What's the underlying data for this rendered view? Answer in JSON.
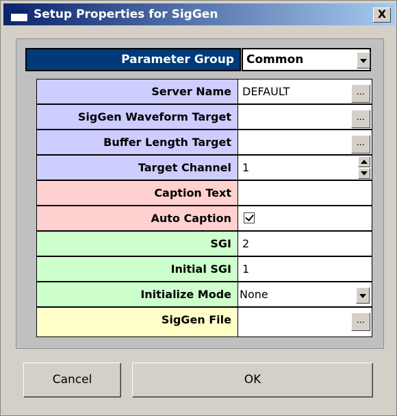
{
  "window": {
    "title": "Setup Properties for SigGen",
    "close_glyph": "X"
  },
  "parameter_group": {
    "label": "Parameter Group",
    "value": "Common"
  },
  "rows": [
    {
      "label": "Server Name",
      "value": "DEFAULT",
      "control": "ellipsis",
      "color": "#cdcdff"
    },
    {
      "label": "SigGen Waveform Target",
      "value": "",
      "control": "ellipsis",
      "color": "#cdcdff"
    },
    {
      "label": "Buffer Length Target",
      "value": "",
      "control": "ellipsis",
      "color": "#cdcdff"
    },
    {
      "label": "Target Channel",
      "value": "1",
      "control": "spinner",
      "color": "#cdcdff"
    },
    {
      "label": "Caption Text",
      "value": "",
      "control": "text",
      "color": "#ffd0d0"
    },
    {
      "label": "Auto Caption",
      "value": "",
      "checked": true,
      "control": "checkbox",
      "color": "#ffd0d0"
    },
    {
      "label": "SGI",
      "value": "2",
      "control": "text",
      "color": "#cdffcd"
    },
    {
      "label": "Initial SGI",
      "value": "1",
      "control": "text",
      "color": "#cdffcd"
    },
    {
      "label": "Initialize Mode",
      "value": "None",
      "control": "dropdown",
      "color": "#cdffcd"
    },
    {
      "label": "SigGen File",
      "value": "",
      "control": "ellipsis",
      "color": "#ffffc8"
    }
  ],
  "ellipsis_glyph": "...",
  "buttons": {
    "cancel": "Cancel",
    "ok": "OK"
  }
}
